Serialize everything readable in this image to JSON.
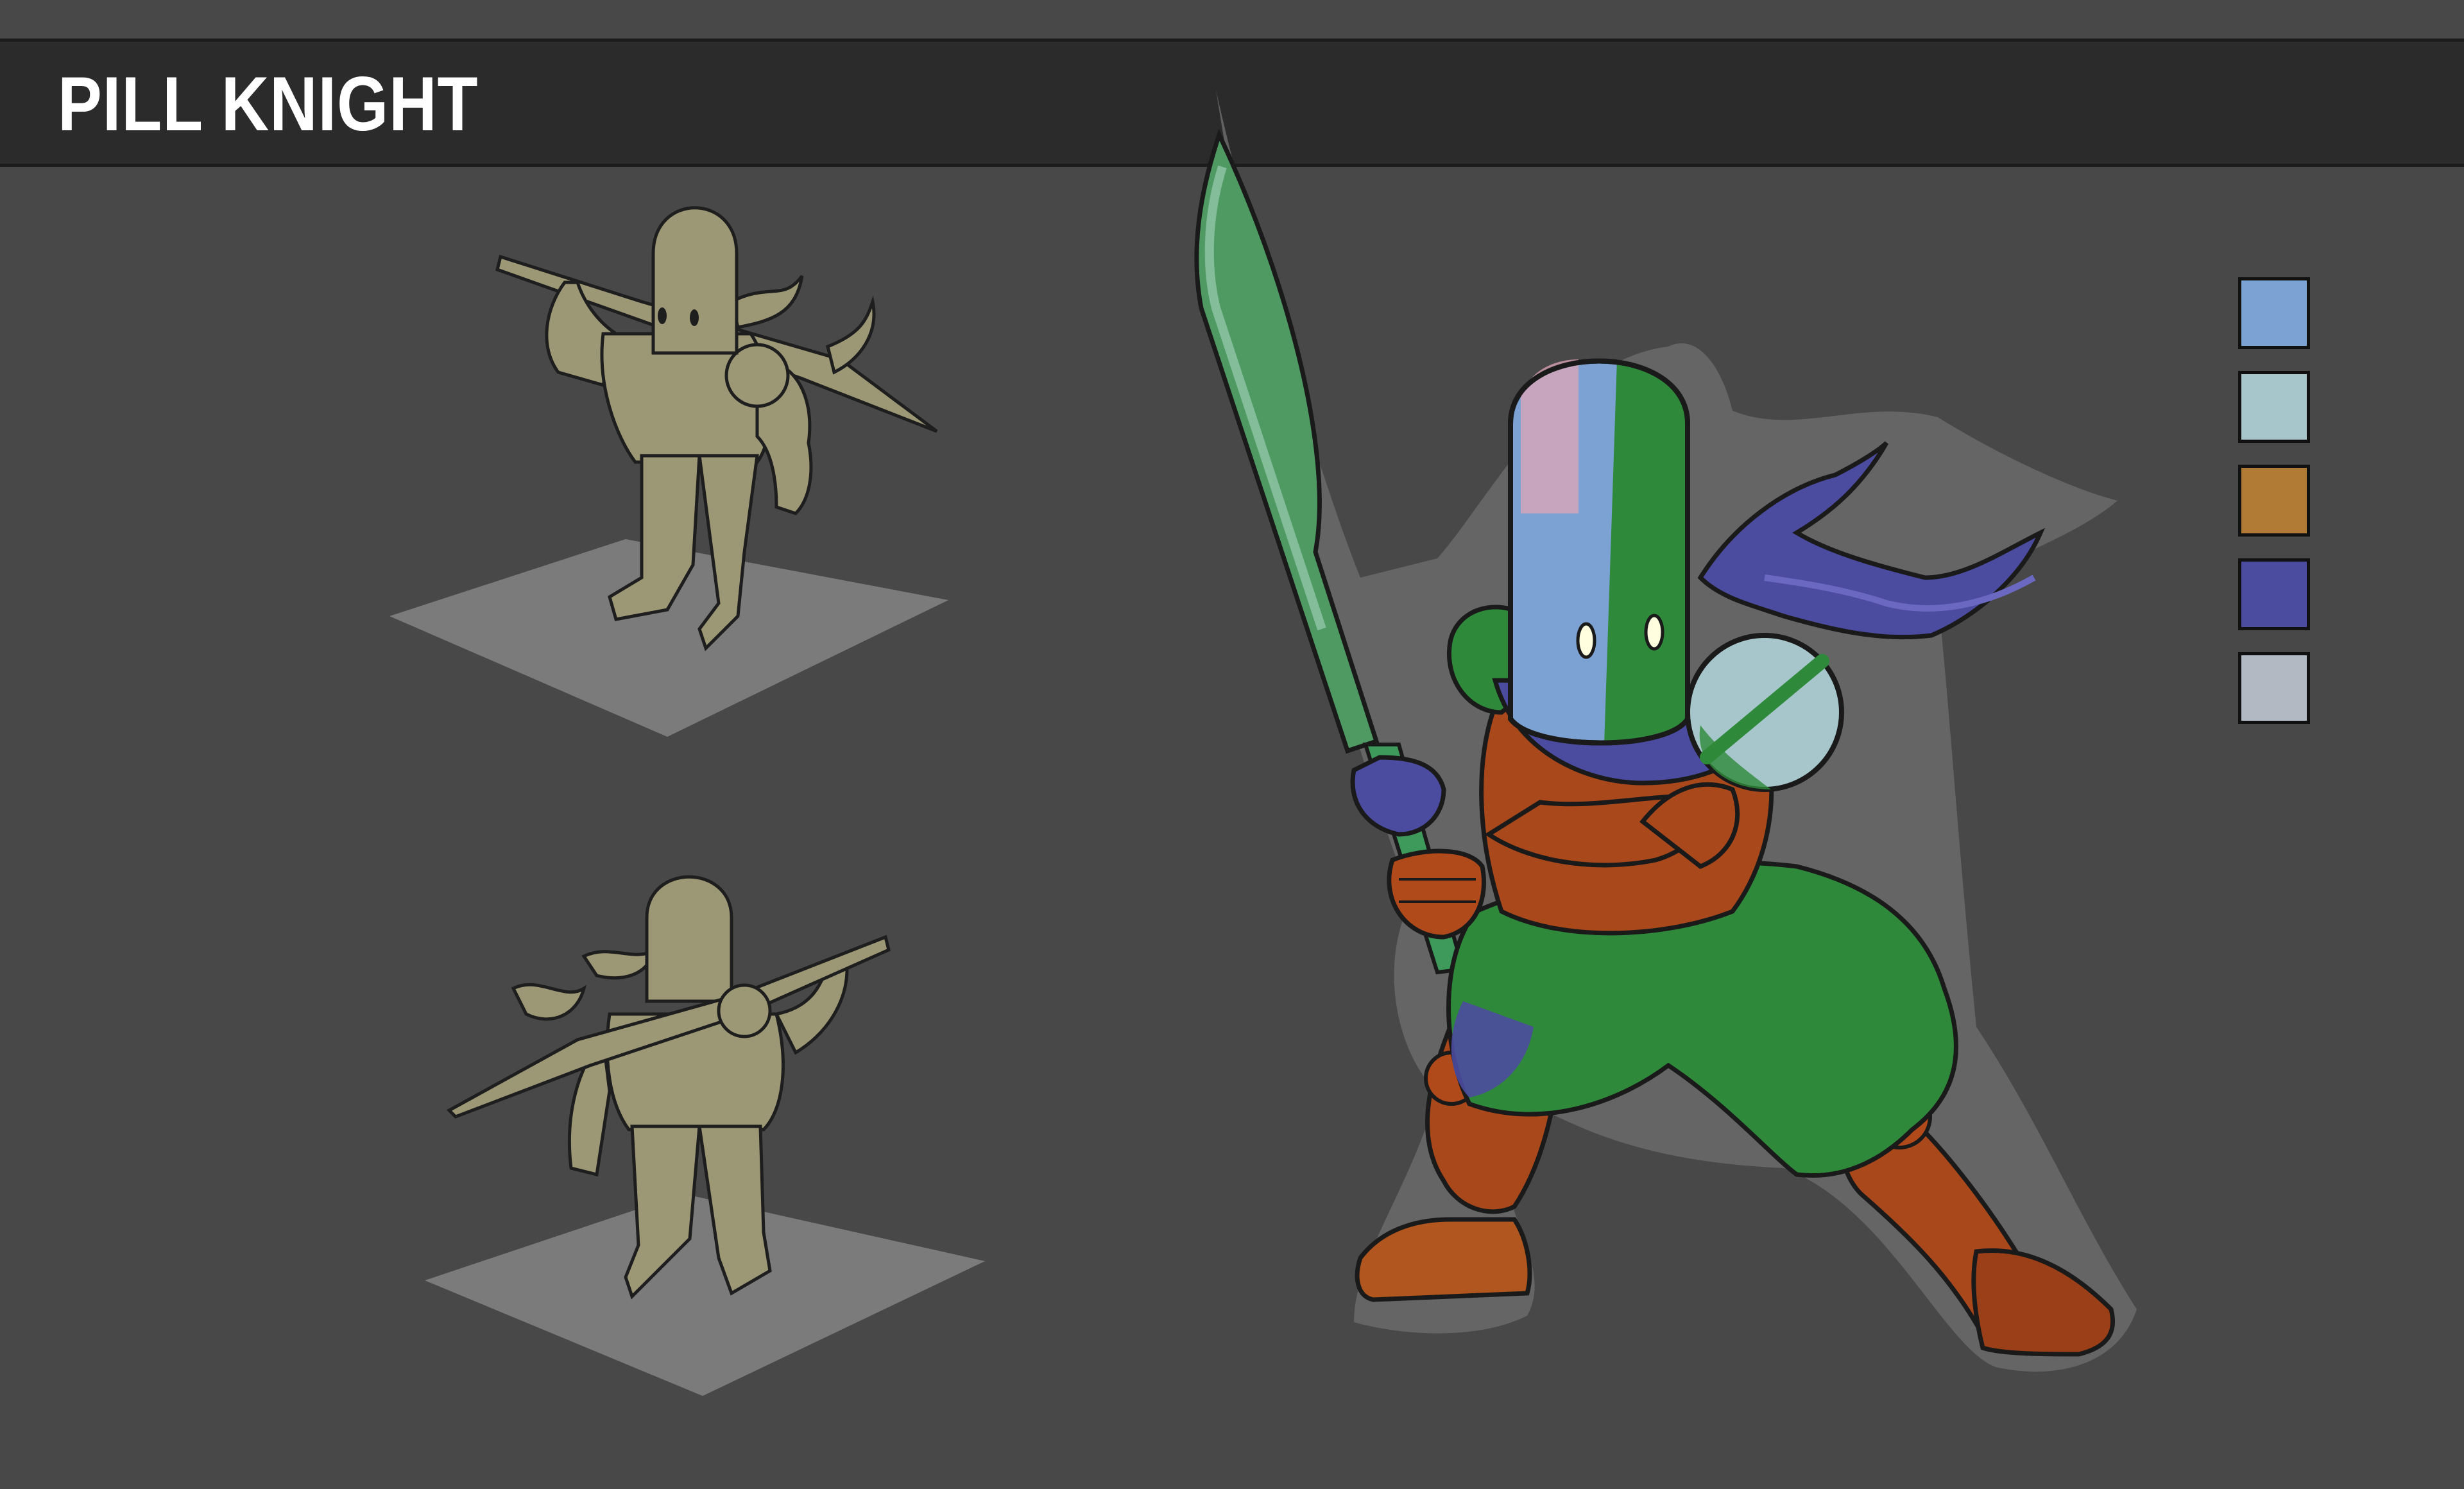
{
  "header": {
    "title": "PILL KNIGHT"
  },
  "palette": {
    "swatches": [
      "#7ba2d2",
      "#a7c6cb",
      "#b27b35",
      "#4b4ba0",
      "#b3b9c2"
    ]
  },
  "colors": {
    "background": "#484848",
    "title_bar": "#2b2b2b",
    "sketch_fill": "#9c9775",
    "platform": "#7b7b7b",
    "armor_green": "#2e8a3a",
    "armor_rust": "#a9481b",
    "scarf_purple": "#4b4ba0",
    "pill_blue": "#7ba2d2"
  }
}
